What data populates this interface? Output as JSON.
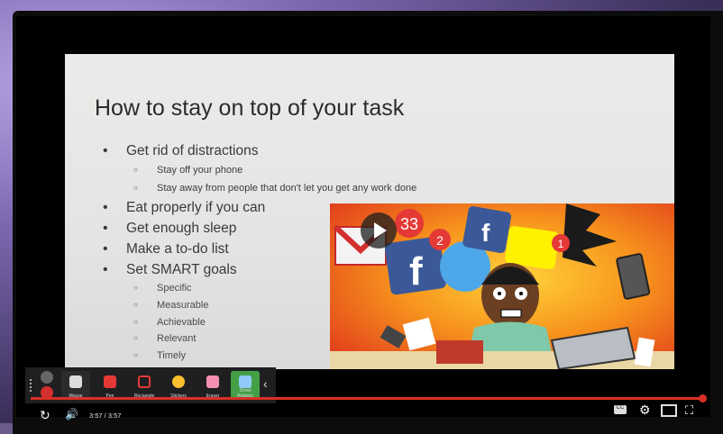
{
  "slide": {
    "title": "How to stay on top of your task",
    "items": [
      {
        "level": 1,
        "text": "Get rid of distractions"
      },
      {
        "level": 2,
        "text": "Stay off your phone"
      },
      {
        "level": 2,
        "text": "Stay away from people that don't let you get any work done"
      },
      {
        "level": 1,
        "text": "Eat properly if you can"
      },
      {
        "level": 1,
        "text": "Get enough sleep"
      },
      {
        "level": 1,
        "text": "Make a to-do list"
      },
      {
        "level": 1,
        "text": "Set SMART goals"
      },
      {
        "level": 3,
        "text": "Specific"
      },
      {
        "level": 3,
        "text": "Measurable"
      },
      {
        "level": 3,
        "text": "Achievable"
      },
      {
        "level": 3,
        "text": "Relevant"
      },
      {
        "level": 3,
        "text": "Timely"
      }
    ],
    "badges": {
      "mail": "33",
      "facebook": "2",
      "red": "1"
    }
  },
  "toolbar": {
    "mouse": "Mouse",
    "pen": "Pen",
    "rectangle": "Rectangle",
    "stickers": "Stickers",
    "eraser": "Eraser",
    "smart": "Smart Widgets"
  },
  "player": {
    "time": "3:57 / 3:57",
    "progress_fraction": 1.0,
    "accent": "#d93025"
  }
}
